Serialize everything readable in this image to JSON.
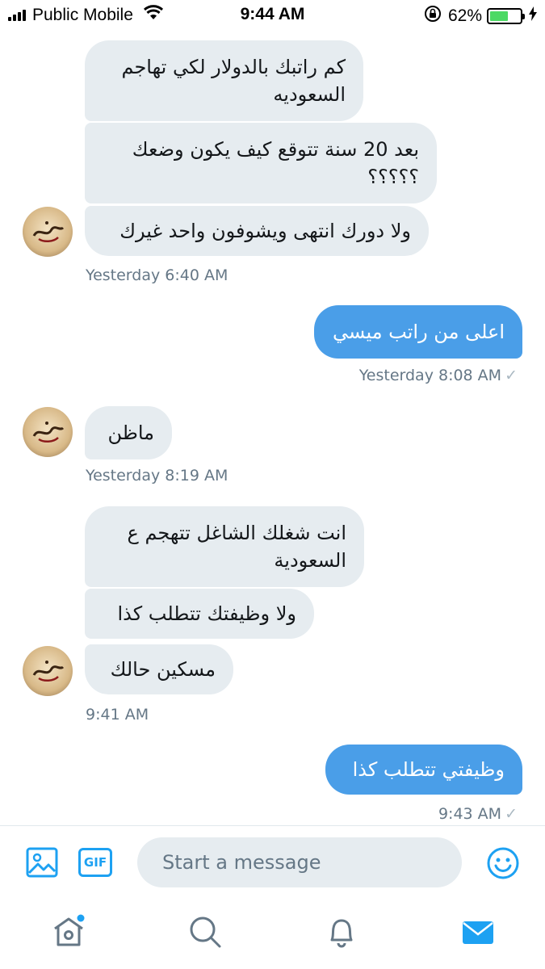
{
  "status_bar": {
    "carrier": "Public Mobile",
    "time": "9:44 AM",
    "battery": "62%",
    "battery_level": 0.62
  },
  "messages": [
    {
      "text": "كم راتبك بالدولار لكي تهاجم السعوديه",
      "direction": "in"
    },
    {
      "text": "بعد 20 سنة تتوقع كيف يكون وضعك ؟؟؟؟؟",
      "direction": "in"
    },
    {
      "text": "ولا دورك انتهى ويشوفون واحد غيرك",
      "direction": "in"
    },
    {
      "timestamp": "Yesterday 6:40 AM"
    },
    {
      "text": "اعلى من راتب ميسي",
      "direction": "out"
    },
    {
      "timestamp": "Yesterday 8:08 AM",
      "check": "✓"
    },
    {
      "text": "ماظن",
      "direction": "in"
    },
    {
      "timestamp": "Yesterday 8:19 AM"
    },
    {
      "text": "انت شغلك الشاغل تتهجم ع السعودية",
      "direction": "in"
    },
    {
      "text": "ولا وظيفتك تتطلب كذا",
      "direction": "in"
    },
    {
      "text": "مسكين حالك",
      "direction": "in"
    },
    {
      "timestamp": "9:41 AM"
    },
    {
      "text": "وظيفتي تتطلب كذا",
      "direction": "out"
    },
    {
      "timestamp": "9:43 AM",
      "check": "✓"
    }
  ],
  "compose": {
    "placeholder": "Start a message",
    "gif_label": "GIF",
    "icons": [
      "image-icon",
      "gif-icon",
      "emoji-icon"
    ]
  },
  "tabs": [
    {
      "name": "home",
      "icon": "home-icon",
      "active": false,
      "has_dot": true
    },
    {
      "name": "search",
      "icon": "search-icon",
      "active": false
    },
    {
      "name": "notifications",
      "icon": "bell-icon",
      "active": false
    },
    {
      "name": "messages",
      "icon": "mail-icon",
      "active": true
    }
  ],
  "colors": {
    "accent": "#1da1f2",
    "outgoing_bubble": "#4a9ee8",
    "incoming_bubble": "#e6ecf0",
    "meta_text": "#657786",
    "battery": "#4cd964"
  }
}
